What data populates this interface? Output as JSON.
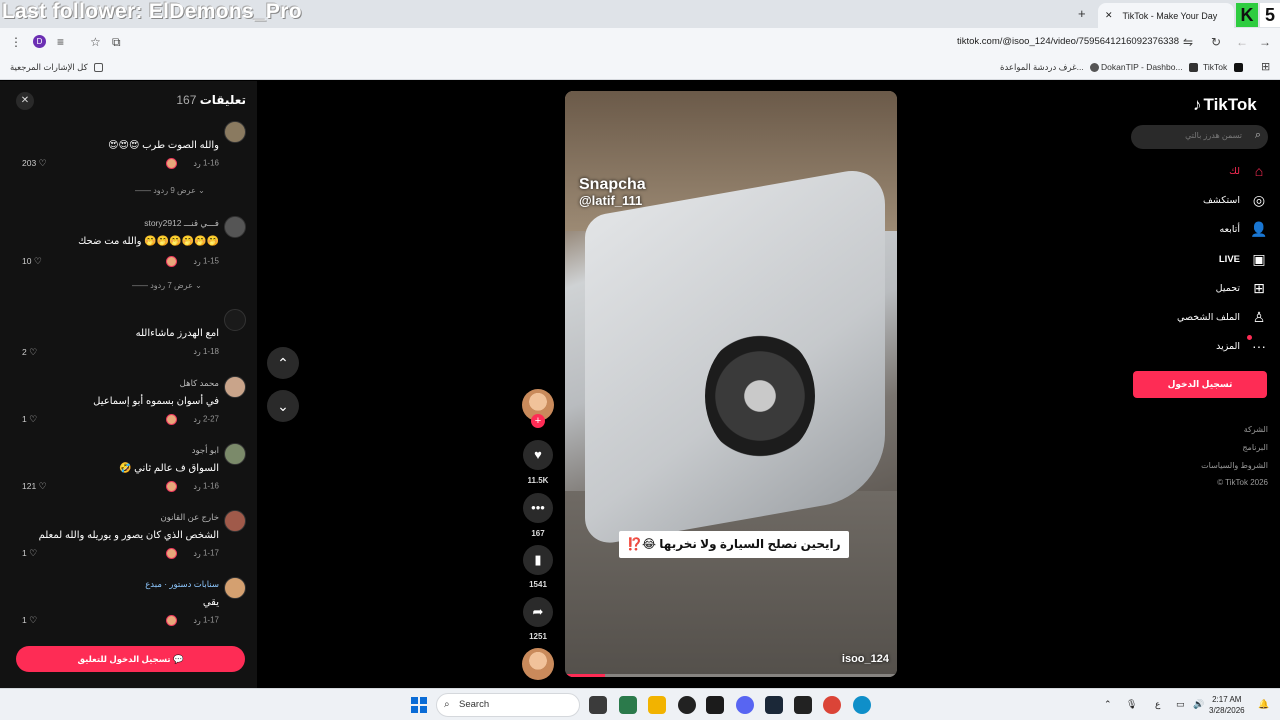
{
  "overlay": {
    "text": "Last follower: ElDemons_Pro"
  },
  "browser": {
    "tab_title": "TikTok - Make Your Day",
    "tab_close": "✕",
    "new_tab": "+",
    "corner_logo_left": "K",
    "corner_logo_right": "5",
    "url": "tiktok.com/@isoo_124/video/7595641216092376338",
    "profile_initial": "D",
    "bookmarks": {
      "all_bookmarks": "كل الإشارات المرجعية",
      "items": [
        "غرف دردشة المواعدة...",
        "DokanTIP - Dashbo...",
        "TikTok"
      ]
    }
  },
  "comments": {
    "title": "تعليقات",
    "count": "167",
    "close": "✕",
    "reply_label": "رد",
    "items": [
      {
        "user": "",
        "text": "والله الصوت طرب 😍😍😍",
        "date": "1-16",
        "likes": "203"
      },
      {
        "user": "فـــي قنـــ story2912",
        "text": "🤭🤭🤭🤭🤭🤭 والله مت ضحك",
        "date": "1-15",
        "likes": "10"
      },
      {
        "user": "",
        "text": "امع الهدرز ماشاءالله",
        "date": "1-18",
        "likes": "2"
      },
      {
        "user": "محمد كاهل",
        "text": "في أسوان بسموه أبو إسماعيل",
        "date": "2-27",
        "likes": "1"
      },
      {
        "user": "ابو أجود",
        "text": "السواق ف عالم ثاني 🤣",
        "date": "1-16",
        "likes": "121"
      },
      {
        "user": "خارج عن القانون",
        "text": "الشخص الذي كان يصور و يوريله والله لمعلم",
        "date": "1-17",
        "likes": "1"
      },
      {
        "user": "سنابات دستور · مبدع",
        "text": "يقي",
        "date": "1-17",
        "likes": "1"
      }
    ],
    "view_replies": [
      "عرض 9 ردود",
      "عرض 7 ردود"
    ],
    "login_to_comment": "تسجيل الدخول للتعليق"
  },
  "video": {
    "snap_line1": "Snapcha",
    "snap_line2": "@latif_111",
    "caption": "رايحين نصلح السيارة ولا نخربها 😂⁉️",
    "author": "isoo_124",
    "progress": 0.12
  },
  "actions": {
    "likes": "11.5K",
    "comments": "167",
    "saves": "1541",
    "shares": "1251"
  },
  "sidebar": {
    "logo": "TikTok",
    "search_placeholder": "تسمن هدرز بالتي",
    "nav": [
      {
        "label": "لك",
        "icon": "home-icon"
      },
      {
        "label": "استكشف",
        "icon": "compass-icon"
      },
      {
        "label": "أتابعه",
        "icon": "following-icon"
      },
      {
        "label": "LIVE",
        "icon": "live-icon"
      },
      {
        "label": "تحميل",
        "icon": "upload-icon"
      },
      {
        "label": "الملف الشخصي",
        "icon": "profile-icon"
      },
      {
        "label": "المزيد",
        "icon": "more-icon"
      }
    ],
    "login": "تسجيل الدخول",
    "footer_links": [
      "الشركة",
      "البرنامج",
      "الشروط والسياسات"
    ],
    "copyright": "© TikTok 2026"
  },
  "taskbar": {
    "search": "Search",
    "lang": "ع",
    "time": "2:17 AM",
    "date": "3/28/2026"
  },
  "colors": {
    "accent": "#fe2c55",
    "panel": "#121212",
    "page": "#000000"
  }
}
